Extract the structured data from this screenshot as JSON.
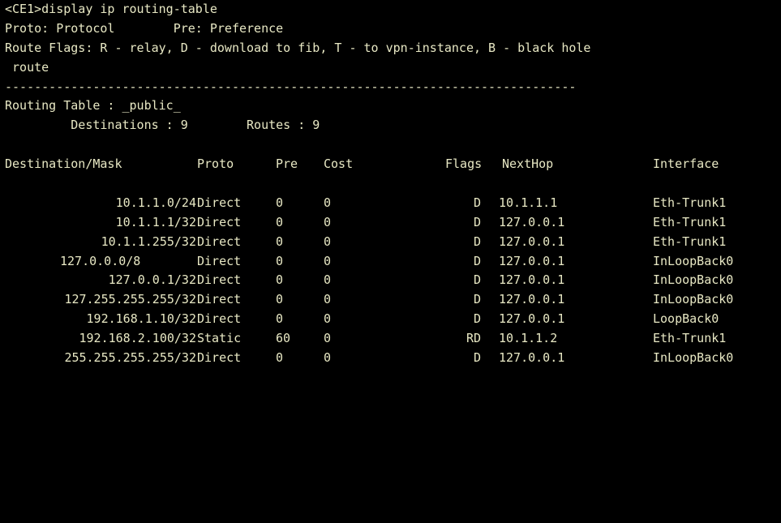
{
  "terminal": {
    "command_line": "<CE1>display ip routing-table",
    "legend_line1": "Proto: Protocol        Pre: Preference",
    "legend_line2": "Route Flags: R - relay, D - download to fib, T - to vpn-instance, B - black hole",
    "legend_line3": " route",
    "separator": "------------------------------------------------------------------------------",
    "table_name_line": "Routing Table : _public_",
    "summary_line": "         Destinations : 9        Routes : 9",
    "blank": "",
    "columns": {
      "destination": "Destination/Mask",
      "proto": "Proto",
      "pre": "Pre",
      "cost": "Cost",
      "flags": "Flags",
      "nexthop": "NextHop",
      "interface": "Interface"
    },
    "routes": [
      {
        "destination": "10.1.1.0/24",
        "proto": "Direct",
        "pre": "0",
        "cost": "0",
        "flags": "D",
        "nexthop": "10.1.1.1",
        "interface": "Eth-Trunk1"
      },
      {
        "destination": "10.1.1.1/32",
        "proto": "Direct",
        "pre": "0",
        "cost": "0",
        "flags": "D",
        "nexthop": "127.0.0.1",
        "interface": "Eth-Trunk1"
      },
      {
        "destination": "10.1.1.255/32",
        "proto": "Direct",
        "pre": "0",
        "cost": "0",
        "flags": "D",
        "nexthop": "127.0.0.1",
        "interface": "Eth-Trunk1"
      },
      {
        "destination": "127.0.0.0/8",
        "proto": "Direct",
        "pre": "0",
        "cost": "0",
        "flags": "D",
        "nexthop": "127.0.0.1",
        "interface": "InLoopBack0"
      },
      {
        "destination": "127.0.0.1/32",
        "proto": "Direct",
        "pre": "0",
        "cost": "0",
        "flags": "D",
        "nexthop": "127.0.0.1",
        "interface": "InLoopBack0"
      },
      {
        "destination": "127.255.255.255/32",
        "proto": "Direct",
        "pre": "0",
        "cost": "0",
        "flags": "D",
        "nexthop": "127.0.0.1",
        "interface": "InLoopBack0"
      },
      {
        "destination": "192.168.1.10/32",
        "proto": "Direct",
        "pre": "0",
        "cost": "0",
        "flags": "D",
        "nexthop": "127.0.0.1",
        "interface": "LoopBack0"
      },
      {
        "destination": "192.168.2.100/32",
        "proto": "Static",
        "pre": "60",
        "cost": "0",
        "flags": "RD",
        "nexthop": "10.1.1.2",
        "interface": "Eth-Trunk1"
      },
      {
        "destination": "255.255.255.255/32",
        "proto": "Direct",
        "pre": "0",
        "cost": "0",
        "flags": "D",
        "nexthop": "127.0.0.1",
        "interface": "InLoopBack0"
      }
    ]
  },
  "colors": {
    "background": "#000000",
    "text": "#e8e8c4"
  }
}
